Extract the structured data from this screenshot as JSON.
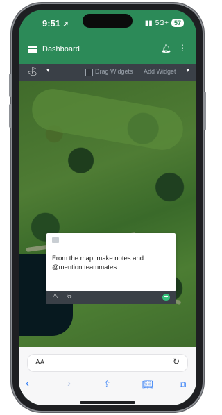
{
  "status_bar": {
    "time": "9:51",
    "location_icon": "location-arrow-icon",
    "network": "5G+",
    "battery": "57"
  },
  "app_bar": {
    "menu_icon": "hamburger-icon",
    "title": "Dashboard",
    "notifications_icon": "bell-icon",
    "more_icon": "kebab-icon"
  },
  "toolbar": {
    "location_icon": "location-tool-icon",
    "drag_widgets_label": "Drag Widgets",
    "add_widget_label": "Add Widget"
  },
  "note_card": {
    "text": "From the map, make notes and @mention teammates."
  },
  "safari": {
    "text_size_label": "AA",
    "reload_icon": "reload-icon",
    "nav_icons": [
      "back-icon",
      "forward-icon",
      "share-icon",
      "bookmarks-icon",
      "tabs-icon"
    ]
  },
  "colors": {
    "brand_green": "#2c8a58",
    "toolbar_dark": "#3a4047",
    "accent_blue": "#2e7bf6",
    "success_green": "#34c07b"
  }
}
